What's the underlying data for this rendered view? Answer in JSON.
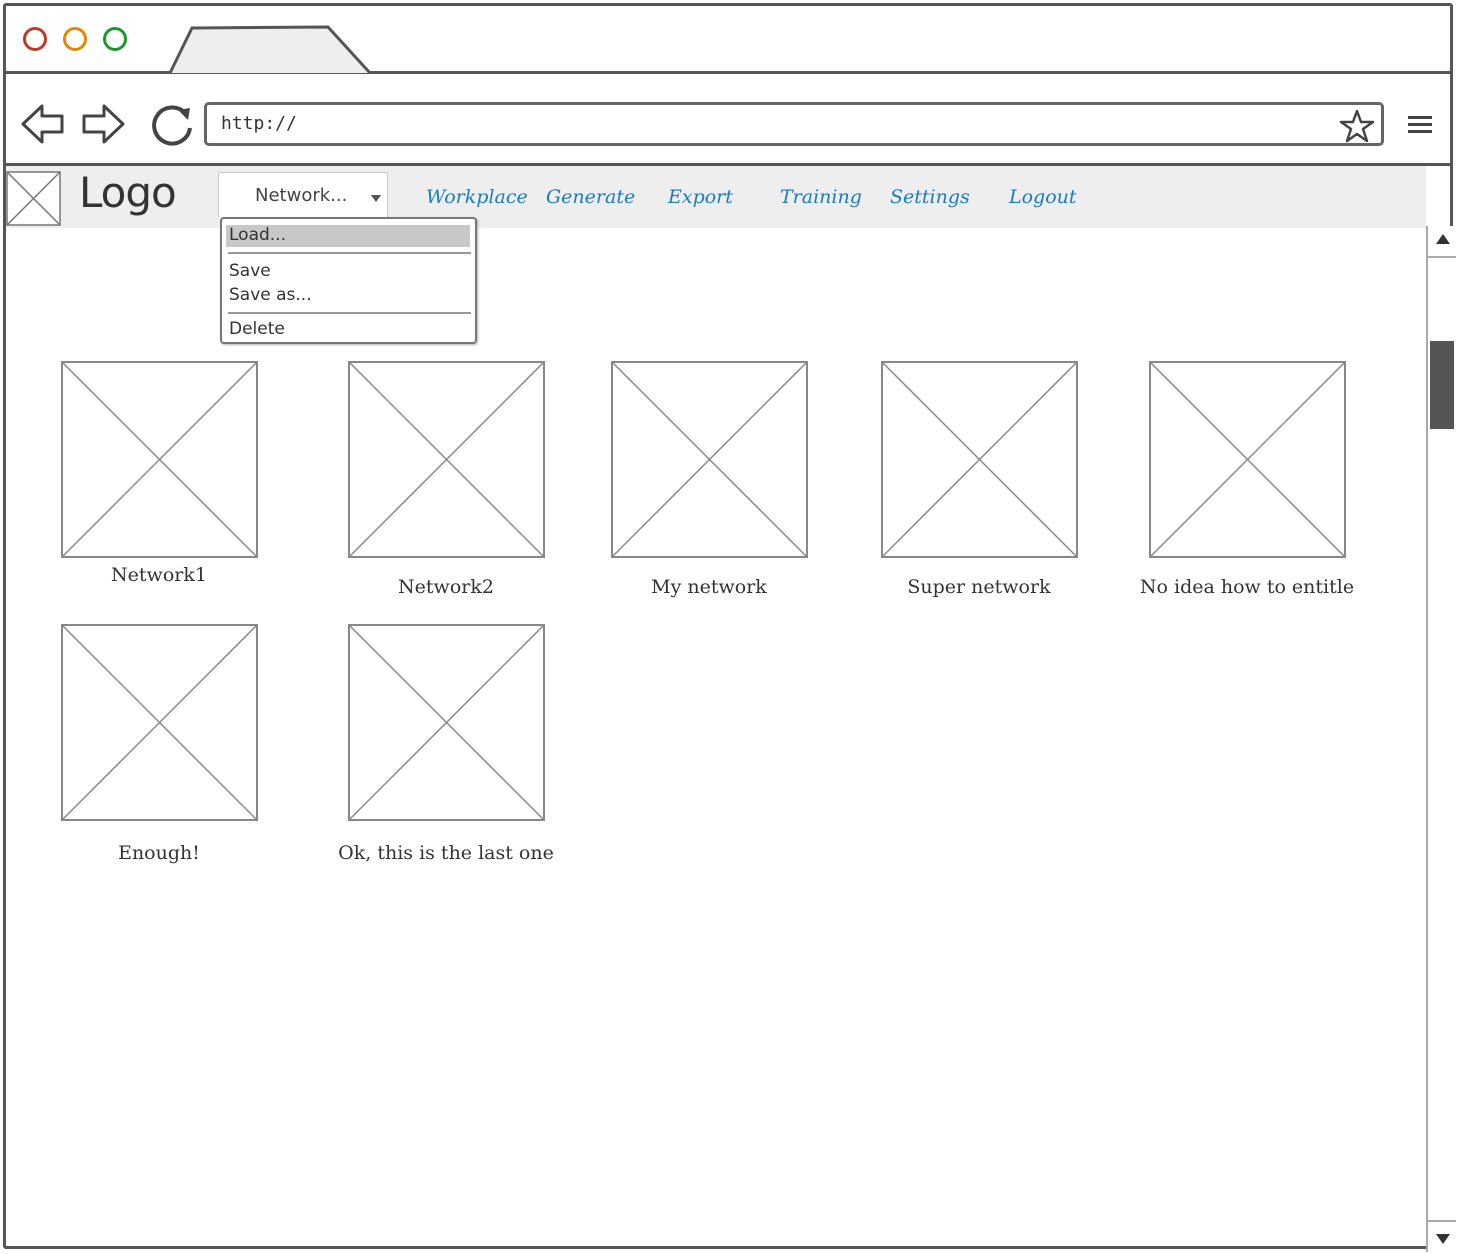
{
  "browser": {
    "url": "http://"
  },
  "app": {
    "logo": "Logo",
    "dropdown_label": "Network...",
    "nav": [
      "Workplace",
      "Generate",
      "Export",
      "Training",
      "Settings",
      "Logout"
    ]
  },
  "menu": {
    "items": [
      "Load...",
      "Save",
      "Save as...",
      "Delete"
    ],
    "selected": "Load..."
  },
  "networks": [
    "Network1",
    "Network2",
    "My network",
    "Super network",
    "No idea how to entitle",
    "Enough!",
    "Ok, this is the last one"
  ],
  "colors": {
    "close": "#c0392b",
    "minimize": "#e08a00",
    "maximize": "#1a9a2a",
    "link": "#1a7bc1"
  }
}
